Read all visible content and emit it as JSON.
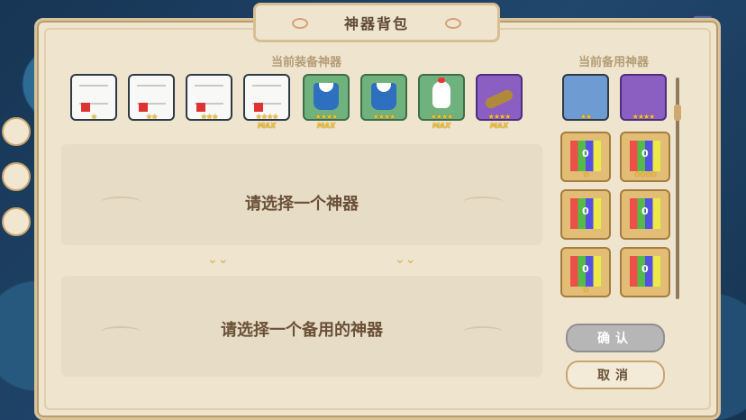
{
  "panel_title": "神器背包",
  "equipped_section_title": "当前装备神器",
  "backup_section_title": "当前备用神器",
  "equipped_items": [
    {
      "name": "paper-1",
      "stars": "★"
    },
    {
      "name": "paper-2",
      "stars": "★★"
    },
    {
      "name": "paper-3",
      "stars": "★★★"
    },
    {
      "name": "paper-4",
      "stars": "★★★★",
      "max": "MAX"
    },
    {
      "name": "uniform-1",
      "stars": "★★★★",
      "max": "MAX"
    },
    {
      "name": "uniform-2",
      "stars": "★★★★"
    },
    {
      "name": "chicken",
      "stars": "★★★★",
      "max": "MAX"
    },
    {
      "name": "cannon",
      "stars": "★★★★",
      "max": "MAX"
    }
  ],
  "backup_items": [
    {
      "name": "pickaxe",
      "stars": "★★"
    },
    {
      "name": "lotus",
      "stars": "★★★★"
    },
    {
      "name": "box-1",
      "stars": "★"
    },
    {
      "name": "box-2",
      "stars": "★★★★"
    },
    {
      "name": "box-3",
      "stars": ""
    },
    {
      "name": "box-4",
      "stars": ""
    },
    {
      "name": "box-5",
      "stars": "★"
    },
    {
      "name": "box-6",
      "stars": ""
    }
  ],
  "prompt_select": "请选择一个神器",
  "prompt_select_backup": "请选择一个备用的神器",
  "buttons": {
    "confirm": "确认",
    "cancel": "取消"
  },
  "colors": {
    "paper": "#efe5cf",
    "accent": "#c8a56f",
    "text": "#6a5038",
    "title": "#b59c77"
  }
}
